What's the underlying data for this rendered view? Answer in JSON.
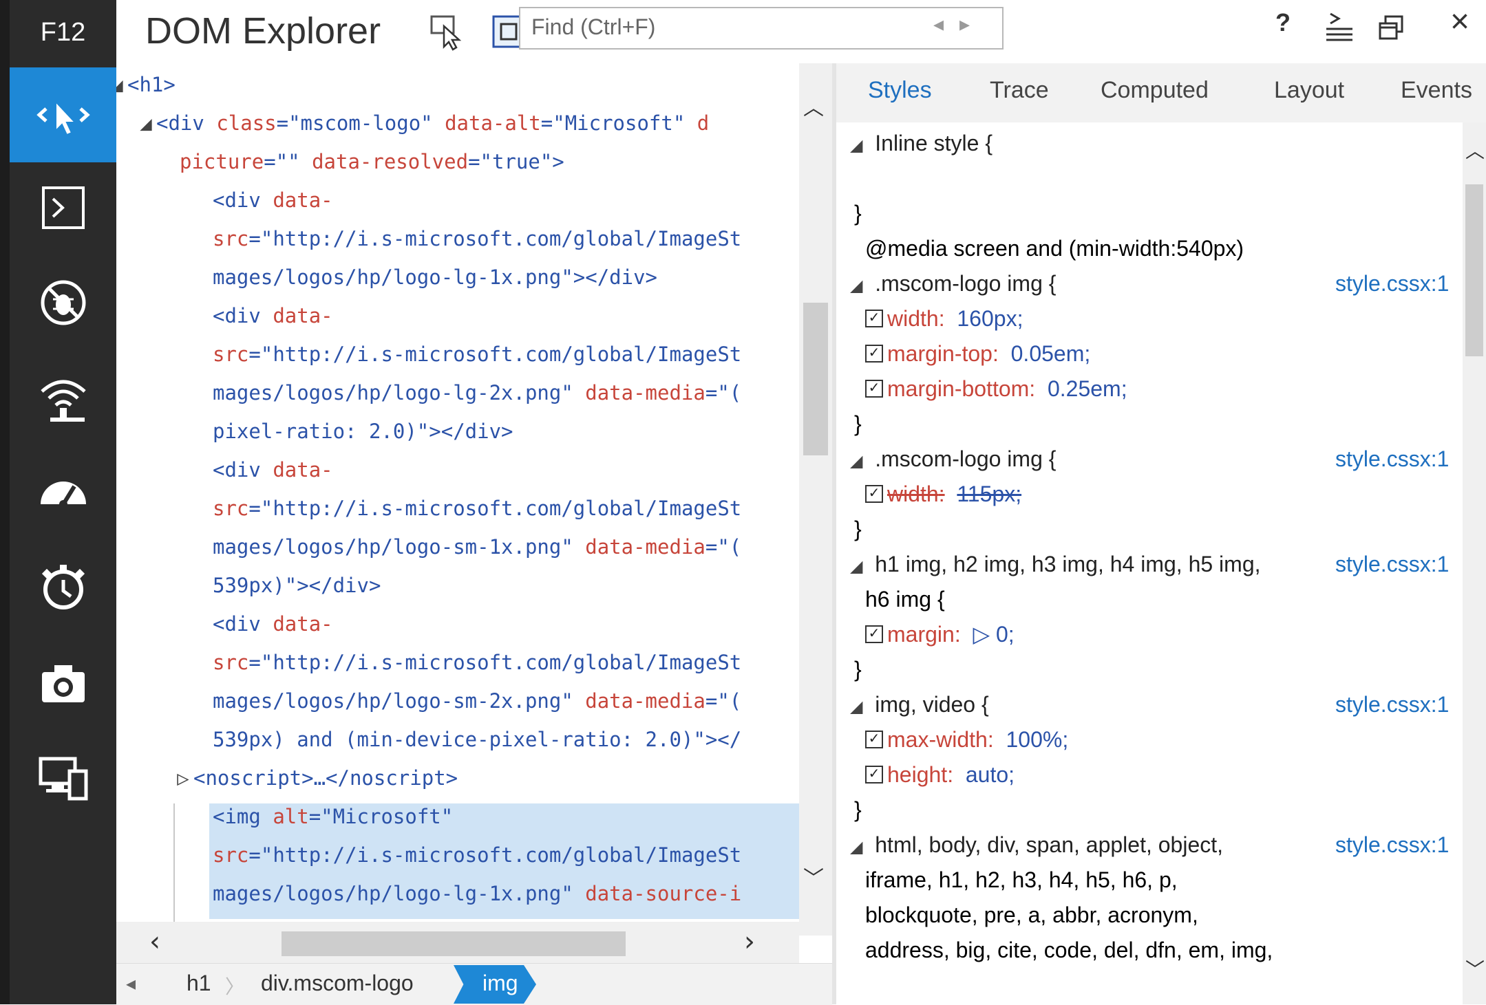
{
  "nav": {
    "f12_label": "F12",
    "items": [
      {
        "icon": "dom-explorer-icon",
        "active": true
      },
      {
        "icon": "console-icon",
        "active": false
      },
      {
        "icon": "debugger-icon",
        "active": false
      },
      {
        "icon": "network-icon",
        "active": false
      },
      {
        "icon": "performance-icon",
        "active": false
      },
      {
        "icon": "memory-icon",
        "active": false
      },
      {
        "icon": "screenshot-icon",
        "active": false
      },
      {
        "icon": "emulation-icon",
        "active": false
      }
    ]
  },
  "header": {
    "title": "DOM Explorer",
    "find_placeholder": "Find (Ctrl+F)",
    "help": "?",
    "close": "×"
  },
  "dom": {
    "lines": [
      {
        "indent": 0,
        "tw": "◢",
        "parts": [
          [
            "tg",
            "<h1>"
          ]
        ]
      },
      {
        "indent": 1,
        "tw": "◢",
        "parts": [
          [
            "tg",
            "<div "
          ],
          [
            "an",
            "class"
          ],
          [
            "pu",
            "="
          ],
          [
            "av",
            "\"mscom-logo\" "
          ],
          [
            "an",
            "data-alt"
          ],
          [
            "pu",
            "="
          ],
          [
            "av",
            "\"Microsoft\" "
          ],
          [
            "an",
            "d"
          ]
        ]
      },
      {
        "indent": 2,
        "tw": "",
        "parts": [
          [
            "an",
            "picture"
          ],
          [
            "pu",
            "="
          ],
          [
            "av",
            "\"\" "
          ],
          [
            "an",
            "data-resolved"
          ],
          [
            "pu",
            "="
          ],
          [
            "av",
            "\"true\""
          ],
          [
            "tg",
            ">"
          ]
        ]
      },
      {
        "indent": 3,
        "tw": "",
        "parts": [
          [
            "tg",
            "<div "
          ],
          [
            "an",
            "data-"
          ]
        ]
      },
      {
        "indent": 3,
        "tw": "",
        "parts": [
          [
            "an",
            "src"
          ],
          [
            "pu",
            "="
          ],
          [
            "av",
            "\"http://i.s-microsoft.com/global/ImageSt"
          ]
        ]
      },
      {
        "indent": 3,
        "tw": "",
        "parts": [
          [
            "av",
            "mages/logos/hp/logo-lg-1x.png\""
          ],
          [
            "tg",
            "></div>"
          ]
        ]
      },
      {
        "indent": 3,
        "tw": "",
        "parts": [
          [
            "tg",
            "<div "
          ],
          [
            "an",
            "data-"
          ]
        ]
      },
      {
        "indent": 3,
        "tw": "",
        "parts": [
          [
            "an",
            "src"
          ],
          [
            "pu",
            "="
          ],
          [
            "av",
            "\"http://i.s-microsoft.com/global/ImageSt"
          ]
        ]
      },
      {
        "indent": 3,
        "tw": "",
        "parts": [
          [
            "av",
            "mages/logos/hp/logo-lg-2x.png\" "
          ],
          [
            "an",
            "data-media"
          ],
          [
            "pu",
            "="
          ],
          [
            "av",
            "\"("
          ]
        ]
      },
      {
        "indent": 3,
        "tw": "",
        "parts": [
          [
            "av",
            "pixel-ratio: 2.0)\""
          ],
          [
            "tg",
            "></div>"
          ]
        ]
      },
      {
        "indent": 3,
        "tw": "",
        "parts": [
          [
            "tg",
            "<div "
          ],
          [
            "an",
            "data-"
          ]
        ]
      },
      {
        "indent": 3,
        "tw": "",
        "parts": [
          [
            "an",
            "src"
          ],
          [
            "pu",
            "="
          ],
          [
            "av",
            "\"http://i.s-microsoft.com/global/ImageSt"
          ]
        ]
      },
      {
        "indent": 3,
        "tw": "",
        "parts": [
          [
            "av",
            "mages/logos/hp/logo-sm-1x.png\" "
          ],
          [
            "an",
            "data-media"
          ],
          [
            "pu",
            "="
          ],
          [
            "av",
            "\"("
          ]
        ]
      },
      {
        "indent": 3,
        "tw": "",
        "parts": [
          [
            "av",
            "539px)\""
          ],
          [
            "tg",
            "></div>"
          ]
        ]
      },
      {
        "indent": 3,
        "tw": "",
        "parts": [
          [
            "tg",
            "<div "
          ],
          [
            "an",
            "data-"
          ]
        ]
      },
      {
        "indent": 3,
        "tw": "",
        "parts": [
          [
            "an",
            "src"
          ],
          [
            "pu",
            "="
          ],
          [
            "av",
            "\"http://i.s-microsoft.com/global/ImageSt"
          ]
        ]
      },
      {
        "indent": 3,
        "tw": "",
        "parts": [
          [
            "av",
            "mages/logos/hp/logo-sm-2x.png\" "
          ],
          [
            "an",
            "data-media"
          ],
          [
            "pu",
            "="
          ],
          [
            "av",
            "\"("
          ]
        ]
      },
      {
        "indent": 3,
        "tw": "",
        "parts": [
          [
            "av",
            "539px) and (min-device-pixel-ratio: 2.0)\""
          ],
          [
            "tg",
            "></"
          ]
        ]
      },
      {
        "indent": 2,
        "tw": "▷",
        "parts": [
          [
            "tg",
            "<noscript>…</noscript>"
          ]
        ]
      },
      {
        "indent": 3,
        "tw": "",
        "parts": [
          [
            "tg",
            "<img "
          ],
          [
            "an",
            "alt"
          ],
          [
            "pu",
            "="
          ],
          [
            "av",
            "\"Microsoft\""
          ]
        ]
      },
      {
        "indent": 3,
        "tw": "",
        "parts": [
          [
            "an",
            "src"
          ],
          [
            "pu",
            "="
          ],
          [
            "av",
            "\"http://i.s-microsoft.com/global/ImageSt"
          ]
        ]
      },
      {
        "indent": 3,
        "tw": "",
        "parts": [
          [
            "av",
            "mages/logos/hp/logo-lg-1x.png\" "
          ],
          [
            "an",
            "data-source-i"
          ]
        ]
      }
    ],
    "breadcrumb": [
      "h1",
      "div.mscom-logo",
      "img"
    ]
  },
  "styles": {
    "tabs": [
      "Styles",
      "Trace",
      "Computed",
      "Layout",
      "Events"
    ],
    "active_tab": "Styles",
    "rows": [
      {
        "type": "sel",
        "tw": "◢",
        "text": "Inline style  {",
        "src": ""
      },
      {
        "type": "blank"
      },
      {
        "type": "brace",
        "text": "}"
      },
      {
        "type": "media",
        "text": "@media screen and (min-width:540px)"
      },
      {
        "type": "sel",
        "tw": "◢",
        "text": ".mscom-logo img  {",
        "src": "style.cssx:1"
      },
      {
        "type": "prop",
        "name": "width",
        "value": "160px;",
        "struck": false
      },
      {
        "type": "prop",
        "name": "margin-top",
        "value": "0.05em;",
        "struck": false
      },
      {
        "type": "prop",
        "name": "margin-bottom",
        "value": "0.25em;",
        "struck": false
      },
      {
        "type": "brace",
        "text": "}"
      },
      {
        "type": "sel",
        "tw": "◢",
        "text": ".mscom-logo img  {",
        "src": "style.cssx:1"
      },
      {
        "type": "prop",
        "name": "width",
        "value": "115px;",
        "struck": true
      },
      {
        "type": "brace",
        "text": "}"
      },
      {
        "type": "sel",
        "tw": "◢",
        "text": "h1 img, h2 img, h3 img, h4 img, h5 img,",
        "src": "style.cssx:1"
      },
      {
        "type": "cont",
        "text": "h6 img  {"
      },
      {
        "type": "prop",
        "name": "margin",
        "value": "▷ 0;",
        "struck": false
      },
      {
        "type": "brace",
        "text": "}"
      },
      {
        "type": "sel",
        "tw": "◢",
        "text": "img, video  {",
        "src": "style.cssx:1"
      },
      {
        "type": "prop",
        "name": "max-width",
        "value": "100%;",
        "struck": false
      },
      {
        "type": "prop",
        "name": "height",
        "value": "auto;",
        "struck": false
      },
      {
        "type": "brace",
        "text": "}"
      },
      {
        "type": "sel",
        "tw": "◢",
        "text": "html, body, div, span, applet, object,",
        "src": "style.cssx:1"
      },
      {
        "type": "cont",
        "text": "iframe, h1, h2, h3, h4, h5, h6, p,"
      },
      {
        "type": "cont",
        "text": "blockquote, pre, a, abbr, acronym,"
      },
      {
        "type": "cont",
        "text": "address, big, cite, code, del, dfn, em, img,"
      }
    ]
  }
}
